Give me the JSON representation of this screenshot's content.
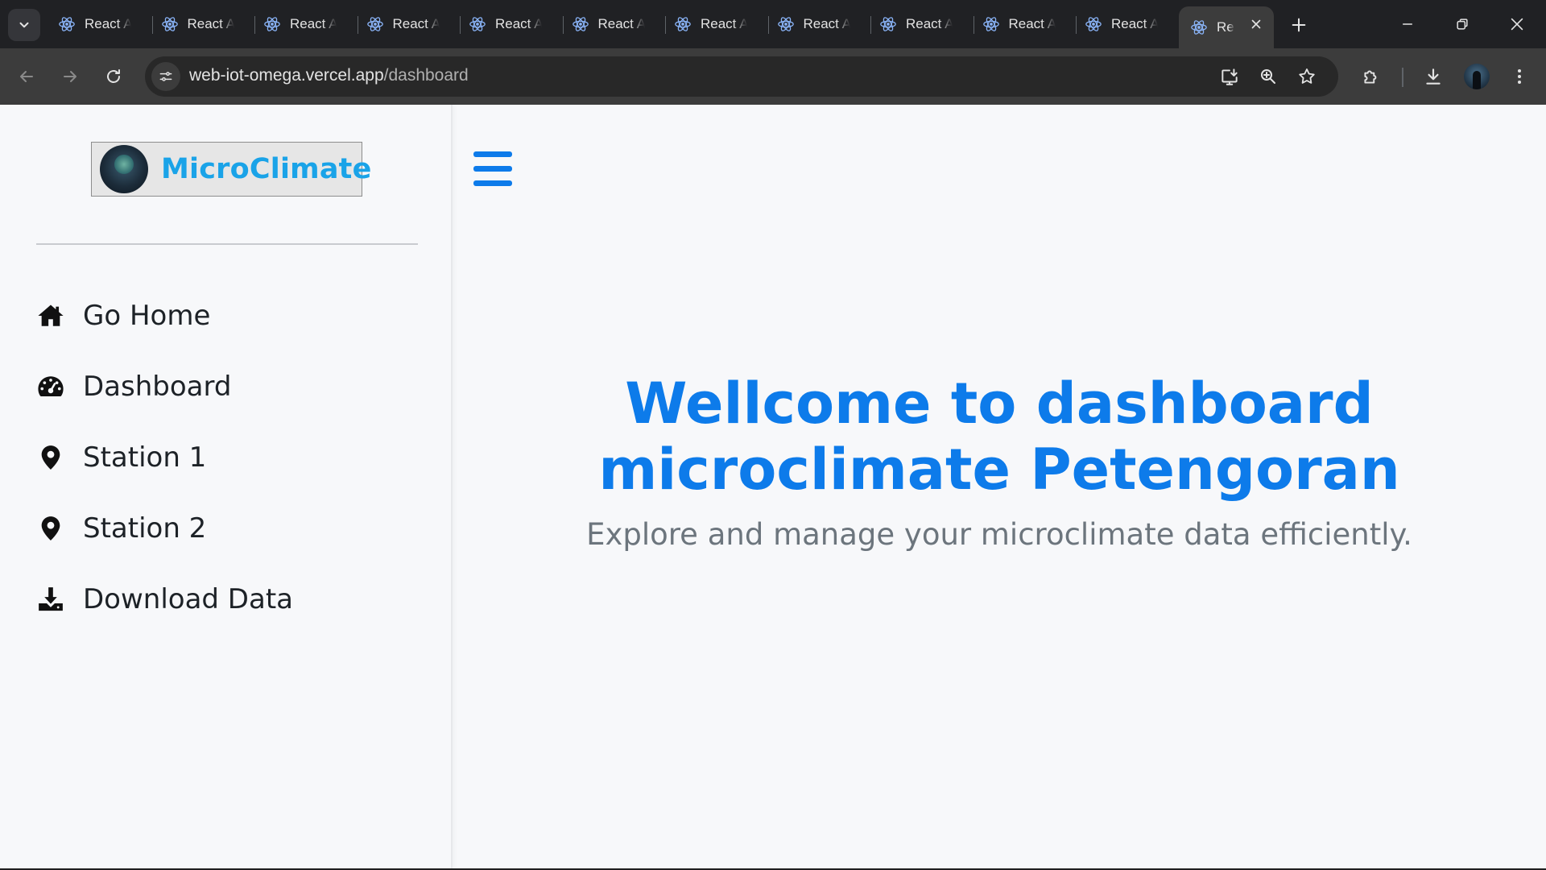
{
  "browser": {
    "tab_search_icon": "chevron-down-icon",
    "tabs": [
      {
        "title": "React A"
      },
      {
        "title": "React A"
      },
      {
        "title": "React A"
      },
      {
        "title": "React A"
      },
      {
        "title": "React A"
      },
      {
        "title": "React A"
      },
      {
        "title": "React A"
      },
      {
        "title": "React A"
      },
      {
        "title": "React A"
      },
      {
        "title": "React A"
      },
      {
        "title": "React A"
      }
    ],
    "active_tab": {
      "title": "React App"
    },
    "url_host": "web-iot-omega.vercel.app",
    "url_path": "/dashboard",
    "colors": {
      "tabstrip": "#202124",
      "toolbar": "#3c3c3c",
      "omnibox": "#282828",
      "react_icon": "#8ab4f8"
    }
  },
  "sidebar": {
    "logo_text": "MicroClimate",
    "items": [
      {
        "label": "Go Home",
        "icon": "home-icon"
      },
      {
        "label": "Dashboard",
        "icon": "gauge-icon"
      },
      {
        "label": "Station 1",
        "icon": "map-pin-icon"
      },
      {
        "label": "Station 2",
        "icon": "map-pin-icon"
      },
      {
        "label": "Download Data",
        "icon": "download-icon"
      }
    ]
  },
  "main": {
    "title_line1": "Wellcome to dashboard",
    "title_line2": "microclimate Petengoran",
    "subtitle": "Explore and manage your microclimate data efficiently.",
    "colors": {
      "accent": "#0d7bea",
      "subtitle": "#6c757d",
      "background": "#f7f8fa"
    }
  }
}
